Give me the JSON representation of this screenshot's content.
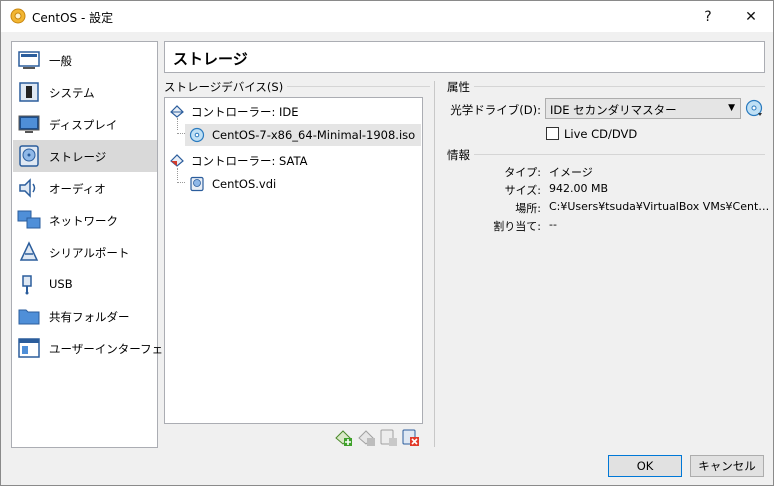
{
  "window": {
    "title": "CentOS - 設定",
    "help_glyph": "?",
    "close_glyph": "✕"
  },
  "sidebar": {
    "items": [
      {
        "label": "一般",
        "icon": "general-icon"
      },
      {
        "label": "システム",
        "icon": "system-icon"
      },
      {
        "label": "ディスプレイ",
        "icon": "display-icon"
      },
      {
        "label": "ストレージ",
        "icon": "storage-icon",
        "selected": true
      },
      {
        "label": "オーディオ",
        "icon": "audio-icon"
      },
      {
        "label": "ネットワーク",
        "icon": "network-icon"
      },
      {
        "label": "シリアルポート",
        "icon": "serial-port-icon"
      },
      {
        "label": "USB",
        "icon": "usb-icon"
      },
      {
        "label": "共有フォルダー",
        "icon": "shared-folder-icon"
      },
      {
        "label": "ユーザーインターフェース",
        "icon": "user-interface-icon"
      }
    ]
  },
  "page": {
    "title": "ストレージ"
  },
  "storage": {
    "group_label": "ストレージデバイス(S)",
    "tree": [
      {
        "label": "コントローラー: IDE",
        "type": "controller"
      },
      {
        "label": "CentOS-7-x86_64-Minimal-1908.iso",
        "type": "optical",
        "selected": true
      },
      {
        "label": "コントローラー: SATA",
        "type": "controller"
      },
      {
        "label": "CentOS.vdi",
        "type": "hdd"
      }
    ]
  },
  "attributes": {
    "group_label": "属性",
    "drive_label": "光学ドライブ(D):",
    "drive_value": "IDE セカンダリマスター",
    "live_cd_label": "Live CD/DVD",
    "live_cd_checked": false
  },
  "info": {
    "group_label": "情報",
    "rows": [
      {
        "label": "タイプ:",
        "value": "イメージ"
      },
      {
        "label": "サイズ:",
        "value": "942.00 MB"
      },
      {
        "label": "場所:",
        "value": "C:¥Users¥tsuda¥VirtualBox VMs¥Cent…"
      },
      {
        "label": "割り当て:",
        "value": "--"
      }
    ]
  },
  "buttons": {
    "ok": "OK",
    "cancel": "キャンセル"
  }
}
